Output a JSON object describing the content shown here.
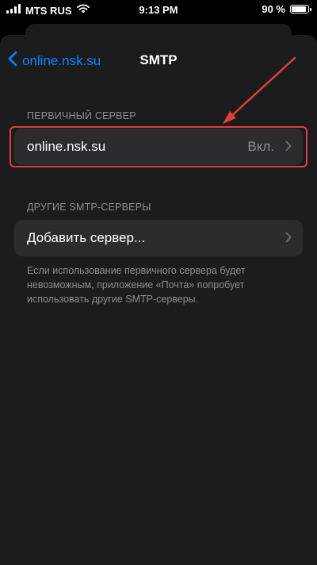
{
  "status_bar": {
    "carrier": "MTS RUS",
    "time": "9:13 PM",
    "battery_text": "90 %",
    "battery_level": 0.9
  },
  "nav": {
    "back_label": "online.nsk.su",
    "title": "SMTP"
  },
  "primary_section": {
    "header": "ПЕРВИЧНЫЙ СЕРВЕР",
    "server": {
      "label": "online.nsk.su",
      "value": "Вкл."
    }
  },
  "other_section": {
    "header": "ДРУГИЕ SMTP-СЕРВЕРЫ",
    "add_label": "Добавить сервер...",
    "footer": "Если использование первичного сервера будет невозможным, приложение «Почта» попробует использовать другие SMTP-серверы."
  },
  "colors": {
    "accent": "#0a84ff",
    "annotation": "#e23d3d"
  }
}
